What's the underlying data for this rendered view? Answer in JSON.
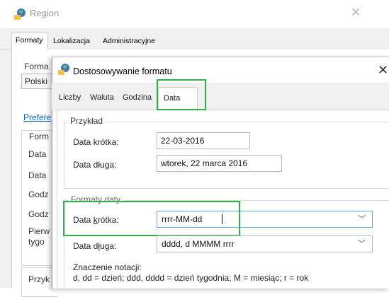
{
  "region": {
    "title": "Region",
    "tabs": [
      "Formaty",
      "Lokalizacja",
      "Administracyjne"
    ],
    "labels": {
      "forma": "Forma",
      "polsk": "Polski",
      "prefere": "Prefere",
      "form": "Form",
      "data1": "Data",
      "data2": "Data",
      "godz1": "Godz",
      "godz2": "Godz",
      "pierw": "Pierw",
      "tygo": "tygo",
      "przyk": "Przyk"
    }
  },
  "dialog": {
    "title": "Dostosowywanie formatu",
    "tabs": {
      "liczby": "Liczby",
      "waluta": "Waluta",
      "godzina": "Godzina",
      "data": "Data"
    },
    "przyklad": {
      "legend": "Przykład",
      "short_label": "Data krótka:",
      "short_value": "22-03-2016",
      "long_label": "Data długa:",
      "long_value": "wtorek, 22 marca 2016"
    },
    "formaty": {
      "legend": "Formaty daty",
      "short_label_pre": "Data ",
      "short_label_acc": "k",
      "short_label_post": "rótka:",
      "short_value": "rrrr-MM-dd",
      "long_label_pre": "Data d",
      "long_label_acc": "ł",
      "long_label_post": "uga:",
      "long_value": "dddd, d MMMM rrrr"
    },
    "notation": {
      "title": "Znaczenie notacji:",
      "line": "d, dd = dzień;  ddd, dddd = dzień tygodnia;  M = miesiąc;  r = rok"
    }
  },
  "colors": {
    "highlight": "#2fb14a",
    "link": "#0a64c8"
  }
}
